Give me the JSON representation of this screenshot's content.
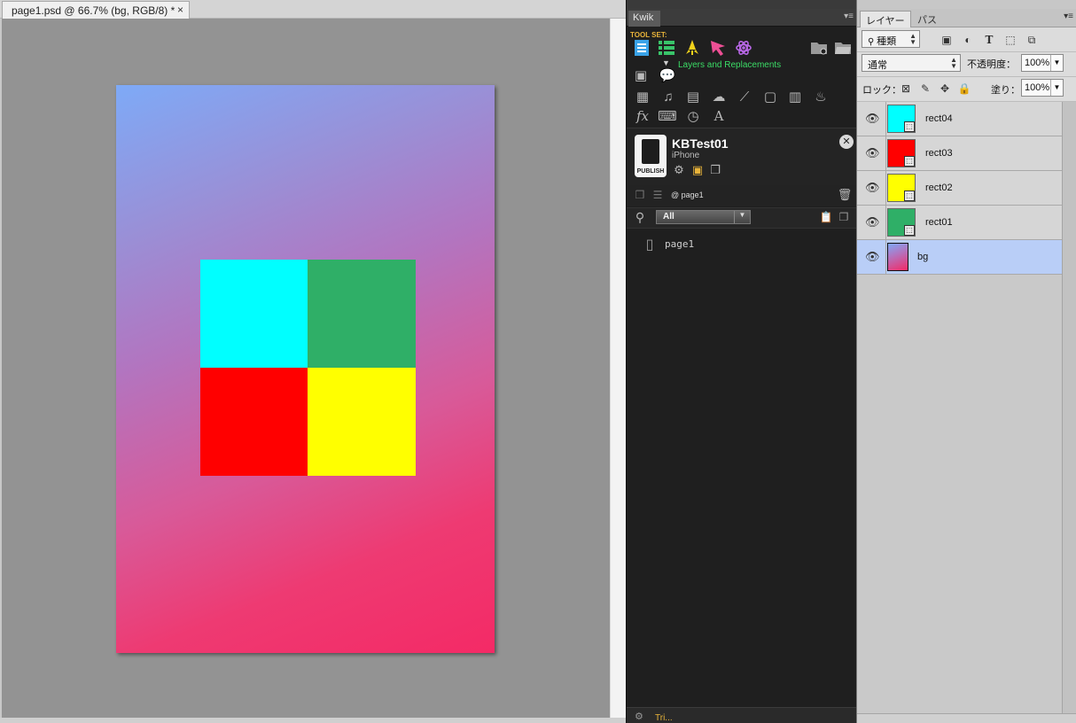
{
  "document": {
    "tab_title": "page1.psd @ 66.7% (bg, RGB/8) *",
    "tab_close": "×",
    "canvas_colors": {
      "gradient_top": "#7eaaf7",
      "gradient_bottom": "#f42a66",
      "cyan": "#00ffff",
      "green": "#2faf67",
      "red": "#ff0000",
      "yellow": "#ffff00"
    }
  },
  "kwik": {
    "tab": "Kwik",
    "toolset_label": "TOOL SET:",
    "layers_replacements_label": "Layers and Replacements",
    "project": {
      "name": "KBTest01",
      "device": "iPhone",
      "publish_label": "PUBLISH",
      "close": "✕"
    },
    "current_page": "@ page1",
    "filter": {
      "selected": "All",
      "arrow": "▼"
    },
    "pages": [
      "page1"
    ],
    "bottom_text": "Tri..."
  },
  "layers_panel": {
    "tabs": [
      "レイヤー",
      "パス"
    ],
    "kind_filter": "種類",
    "blend_mode": "通常",
    "opacity_label": "不透明度：",
    "opacity": "100%",
    "lock_label": "ロック：",
    "fill_label": "塗り：",
    "fill": "100%",
    "layers": [
      {
        "name": "rect04",
        "thumb_color": "#00ffff",
        "selected": false
      },
      {
        "name": "rect03",
        "thumb_color": "#ff0000",
        "selected": false
      },
      {
        "name": "rect02",
        "thumb_color": "#ffff00",
        "selected": false
      },
      {
        "name": "rect01",
        "thumb_color": "#2faf67",
        "selected": false
      },
      {
        "name": "bg",
        "thumb_color": "gradient",
        "selected": true
      }
    ]
  }
}
